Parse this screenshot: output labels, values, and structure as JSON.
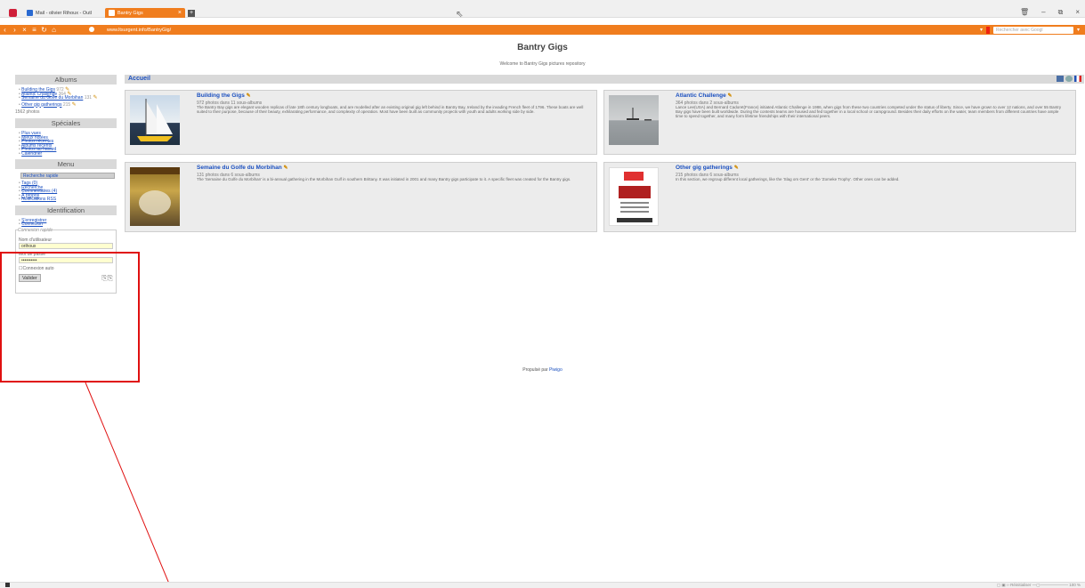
{
  "browser": {
    "tabs": [
      {
        "label": "Mail - olivier Rihoux - Outl"
      },
      {
        "label": "Bantry Gigs"
      }
    ],
    "url": "www.ltsurgent.info/BantryGig/",
    "search_placeholder": "Rechercher avec Googl"
  },
  "page": {
    "title": "Bantry Gigs",
    "subtitle": "Welcome to Bantry Gigs pictures repository",
    "footer_prefix": "Propulsé par",
    "footer_link": "Piwigo"
  },
  "sidebar": {
    "albums_header": "Albums",
    "albums": [
      {
        "label": "Building the Gigs",
        "count": "972"
      },
      {
        "label": "Atlantic Challenge",
        "count": "364"
      },
      {
        "label": "Semaine du Golfe du Morbihan",
        "count": "131"
      },
      {
        "label": "Other gig gatherings",
        "count": "215"
      }
    ],
    "photos_total": "1562 photos",
    "speciales_header": "Spéciales",
    "speciales": [
      "Plus vues",
      "Mieux notées",
      "Photos récentes",
      "Albums récents",
      "Photos au hasard",
      "Calendrier"
    ],
    "menu_header": "Menu",
    "quick_search_placeholder": "Recherche rapide",
    "menu_items": [
      "Tags (0)",
      "Recherche",
      "Commentaires (4)",
      "À propos",
      "Notifications RSS"
    ],
    "ident_header": "Identification",
    "ident_links": [
      "S'enregistrer",
      "Connexion"
    ],
    "quick_connect_legend": "Connexion rapide",
    "username_label": "Nom d'utilisateur",
    "username_value": "orihoux",
    "password_label": "Mot de passe",
    "password_value": "••••••••••",
    "auto_login_label": "Connexion auto",
    "submit_label": "Valider"
  },
  "content": {
    "section_title": "Accueil",
    "cards": [
      {
        "title": "Building the Gigs",
        "nb": "972 photos dans 11 sous-albums",
        "desc": "The Bantry Bay gigs are elegant wooden replicas of late 18th century longboats, and are modelled after an existing original gig left behind in Bantry Bay, Ireland by the invading French fleet of 1796. These boats are well suited to their purpose, because of their beauty, exhilarating performance, and complexity of operation. Most have been built as community projects with youth and adults working side by side."
      },
      {
        "title": "Atlantic Challenge",
        "nb": "364 photos dans 2 sous-albums",
        "desc": "Lance Lee(USA) and Bernard Cadoret(France) initiated Atlantic Challenge in 1986, when gigs from these two countries competed under the status of liberty. Since, we have grown to over 12 nations, and over 55 Bantry Bay gigs have been built worldwide. During the contests teams are housed and fed together in a local school or campground. Besides their daily efforts on the water, team members from different countries have ample time to spend together, and many form lifetime friendships with their international peers."
      },
      {
        "title": "Semaine du Golfe du Morbihan",
        "nb": "131 photos dans 6 sous-albums",
        "desc": "The 'Semaine du Golfe du Morbihan' is a bi-annual gathering in the Morbihan Gulf in southern Brittany. It was initiated in 2001 and many Bantry gigs participate to it. A specific fleet was created for the Bantry gigs."
      },
      {
        "title": "Other gig gatherings",
        "nb": "215 photos dans 6 sous-albums",
        "desc": "In this section, we regroup different local gatherings, like the 'Slag om Gent' or the 'Zomeke Trophy'. Other ones can be added."
      }
    ]
  },
  "statusbar": {
    "zoom_label": "Réinitialiser",
    "zoom_value": "100 %"
  },
  "colors": {
    "accent": "#f07d1e",
    "link": "#1a4fbf",
    "highlight_box": "#e01010"
  }
}
